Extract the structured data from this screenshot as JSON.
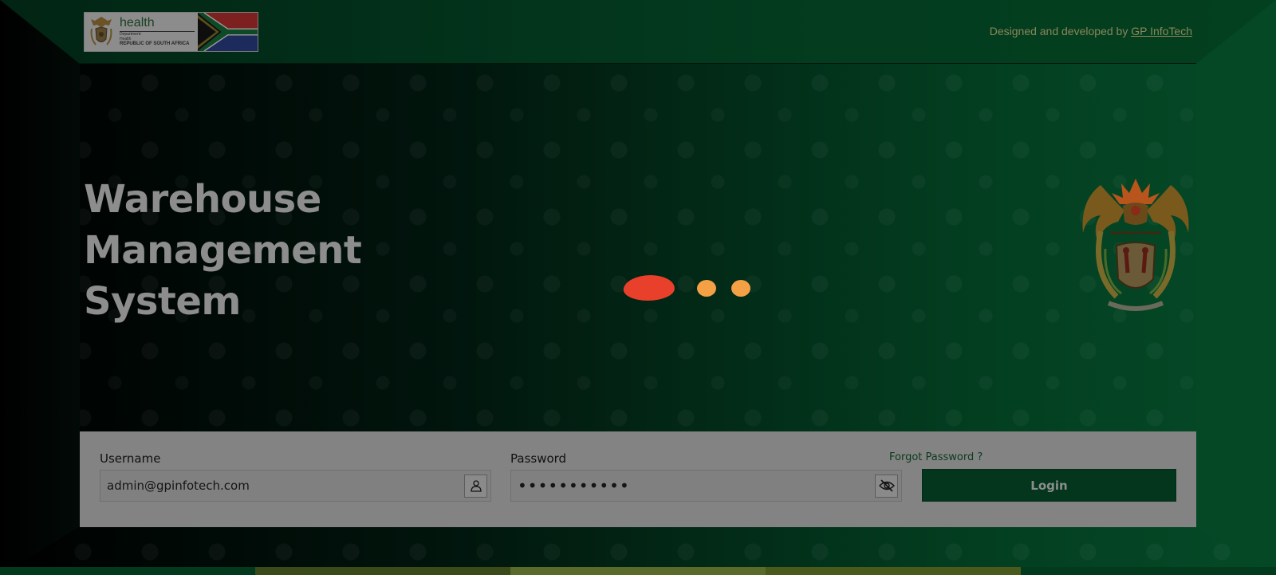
{
  "header": {
    "logo": {
      "title": "health",
      "line1": "Department:",
      "line2": "Health",
      "line3": "REPUBLIC OF SOUTH AFRICA"
    },
    "credit_prefix": "Designed and developed by",
    "credit_link": "GP InfoTech"
  },
  "hero": {
    "title_lines": [
      "Warehouse",
      "Management",
      "System"
    ]
  },
  "login": {
    "username_label": "Username",
    "username_value": "admin@gpinfotech.com",
    "password_label": "Password",
    "password_value": "•••••••••••",
    "forgot_label": "Forgot Password ?",
    "login_label": "Login"
  },
  "icons": {
    "user": "user-icon",
    "eye_off": "eye-off-icon",
    "loader": "loading-dots"
  },
  "colors": {
    "brand_green": "#03361c",
    "loader_red": "#e8402b",
    "loader_orange": "#f4a045",
    "panel_gray": "#838383"
  }
}
